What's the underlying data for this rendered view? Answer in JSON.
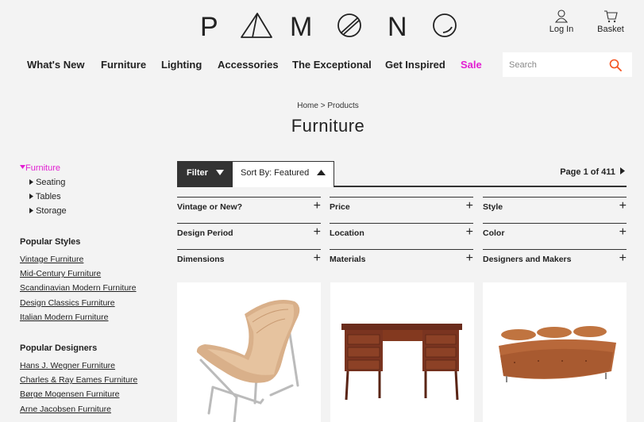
{
  "brand": {
    "letters": [
      "P",
      "A",
      "M",
      "O",
      "N",
      "O"
    ]
  },
  "header": {
    "login_label": "Log In",
    "basket_label": "Basket"
  },
  "nav": {
    "items": [
      "What's New",
      "Furniture",
      "Lighting",
      "Accessories",
      "The Exceptional",
      "Get Inspired",
      "Sale"
    ],
    "sale_color": "#e21fd2"
  },
  "search": {
    "placeholder": "Search",
    "icon": "search-icon",
    "icon_color": "#f4511e"
  },
  "breadcrumb": {
    "home": "Home",
    "separator": ">",
    "current": "Products"
  },
  "page_title": "Furniture",
  "sidebar": {
    "active_category": "Furniture",
    "subcategories": [
      "Seating",
      "Tables",
      "Storage"
    ],
    "popular_styles_heading": "Popular Styles",
    "popular_styles": [
      "Vintage Furniture",
      "Mid-Century Furniture",
      "Scandinavian Modern Furniture",
      "Design Classics Furniture",
      "Italian Modern Furniture"
    ],
    "popular_designers_heading": "Popular Designers",
    "popular_designers": [
      "Hans J. Wegner Furniture",
      "Charles & Ray Eames Furniture",
      "Børge Mogensen Furniture",
      "Arne Jacobsen Furniture"
    ]
  },
  "toolbar": {
    "filter_label": "Filter",
    "sort_label": "Sort By: Featured",
    "page_info": "Page 1 of 411"
  },
  "filters": [
    "Vintage or New?",
    "Price",
    "Style",
    "Design Period",
    "Location",
    "Color",
    "Dimensions",
    "Materials",
    "Designers and Makers"
  ],
  "products": [
    {
      "image": "bent-plywood-lounge-chair"
    },
    {
      "image": "teak-writing-desk"
    },
    {
      "image": "leather-daybed"
    }
  ]
}
